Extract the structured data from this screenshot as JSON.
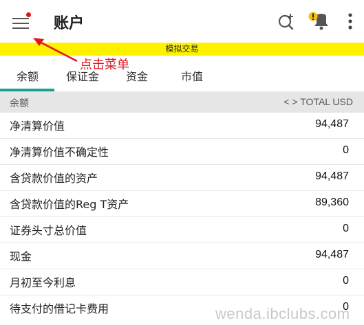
{
  "header": {
    "title": "账户",
    "menu_icon": "hamburger-menu-icon",
    "menu_badge_color": "#e4141b",
    "icons": [
      "add-search-icon",
      "alert-bell-icon",
      "more-vert-icon"
    ]
  },
  "simulated_banner": "模拟交易",
  "annotation": {
    "text": "点击菜单",
    "color": "#e4141b"
  },
  "tabs": [
    {
      "label": "余额",
      "active": true
    },
    {
      "label": "保证金",
      "active": false
    },
    {
      "label": "资金",
      "active": false
    },
    {
      "label": "市值",
      "active": false
    }
  ],
  "accent_color": "#1a9e8f",
  "section": {
    "label": "余额",
    "currency_toggle": "< > TOTAL USD"
  },
  "rows": [
    {
      "name": "净清算价值",
      "value": "94,487"
    },
    {
      "name": "净清算价值不确定性",
      "value": "0"
    },
    {
      "name": "含贷款价值的资产",
      "value": "94,487"
    },
    {
      "name": "含贷款价值的Reg T资产",
      "value": "89,360"
    },
    {
      "name": "证券头寸总价值",
      "value": "0"
    },
    {
      "name": "现金",
      "value": "94,487"
    },
    {
      "name": "月初至今利息",
      "value": "0"
    },
    {
      "name": "待支付的借记卡费用",
      "value": "0"
    }
  ],
  "watermark": "wenda.ibclubs.com"
}
